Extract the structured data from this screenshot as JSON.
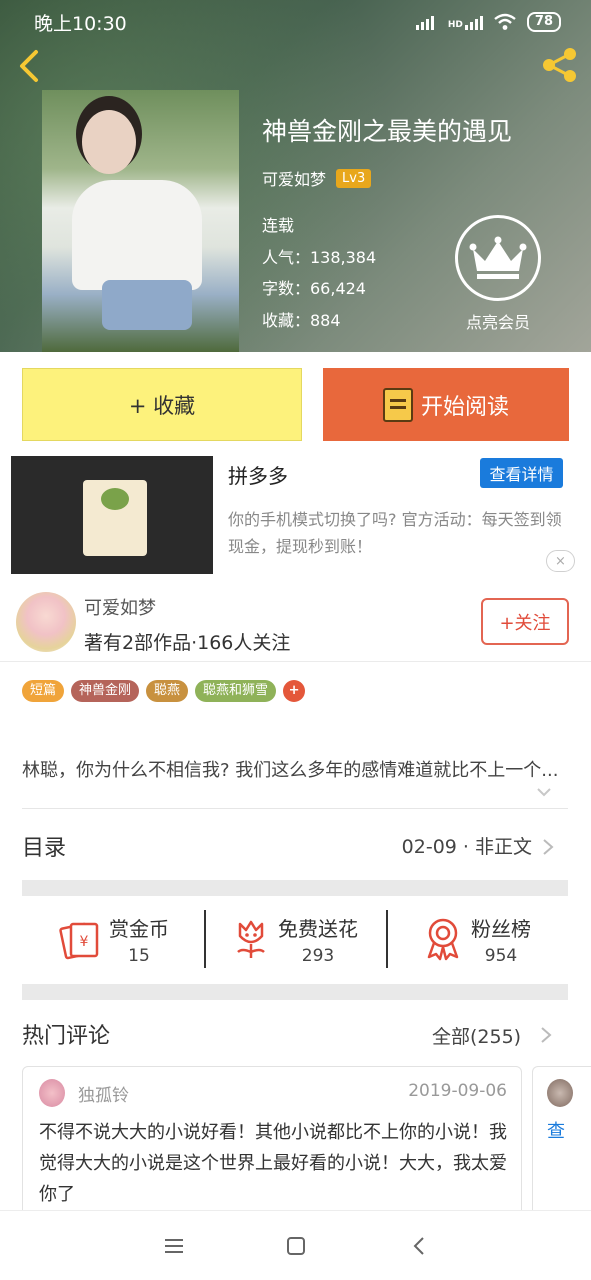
{
  "status_bar": {
    "time": "晚上10:30",
    "signal_label": "HD",
    "battery": "78"
  },
  "book": {
    "title": "神兽金刚之最美的遇见",
    "author": "可爱如梦",
    "level": "Lv3",
    "status": "连载",
    "popularity": "人气：138,384",
    "word_count": "字数：66,424",
    "favorites": "收藏：884"
  },
  "vip": {
    "label": "点亮会员"
  },
  "buttons": {
    "collect": "+ 收藏",
    "read": "开始阅读"
  },
  "ad": {
    "title": "拼多多",
    "detail_label": "查看详情",
    "description": "你的手机模式切换了吗? 官方活动：每天签到领现金，提现秒到账！",
    "close_label": "×"
  },
  "author_section": {
    "name": "可爱如梦",
    "meta": "著有2部作品·166人关注",
    "follow_label": "+关注"
  },
  "tags": [
    {
      "label": "短篇",
      "color": "#f0a43a"
    },
    {
      "label": "神兽金刚",
      "color": "#b5645a"
    },
    {
      "label": "聪燕",
      "color": "#c8913f"
    },
    {
      "label": "聪燕和狮雪",
      "color": "#8fb259"
    }
  ],
  "tag_add_label": "+",
  "summary": "林聪，你为什么不相信我? 我们这么多年的感情难道就比不上一个...",
  "catalog": {
    "label": "目录",
    "latest": "02-09 · 非正文"
  },
  "actions": [
    {
      "label": "赏金币",
      "value": "15",
      "icon": "red-envelope-icon"
    },
    {
      "label": "免费送花",
      "value": "293",
      "icon": "flower-icon"
    },
    {
      "label": "粉丝榜",
      "value": "954",
      "icon": "medal-icon"
    }
  ],
  "hot_comments": {
    "title": "热门评论",
    "all_label": "全部(255)",
    "items": [
      {
        "user": "独孤铃",
        "date": "2019-09-06",
        "text": "不得不说大大的小说好看！其他小说都比不上你的小说！我觉得大大的小说是这个世界上最好看的小说！大大，我太爱你了"
      },
      {
        "link": "查"
      }
    ]
  },
  "colors": {
    "accent_red": "#e14b3a",
    "read_button": "#e8683c",
    "collect_button": "#fdf27c",
    "link_blue": "#1a7bdc"
  }
}
